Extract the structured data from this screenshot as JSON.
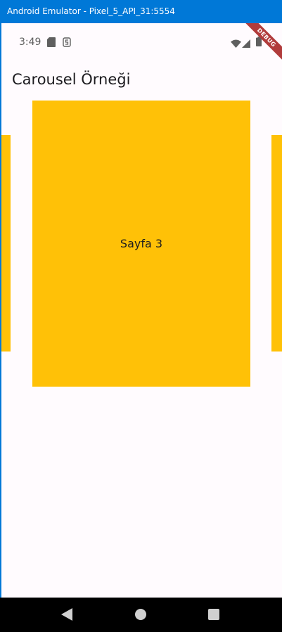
{
  "window": {
    "title": "Android Emulator - Pixel_5_API_31:5554"
  },
  "status_bar": {
    "time": "3:49",
    "icons": [
      "sd-card-icon",
      "notification-s-icon",
      "wifi-icon",
      "cell-signal-icon",
      "battery-icon"
    ]
  },
  "app_bar": {
    "title": "Carousel Örneği"
  },
  "carousel": {
    "current_page_label": "Sayfa 3",
    "page_color": "#ffc107"
  },
  "debug_banner": {
    "label": "DEBUG"
  },
  "nav_bar": {
    "buttons": [
      "back-icon",
      "home-icon",
      "recents-icon"
    ]
  },
  "colors": {
    "titlebar": "#0078d7",
    "screen_background": "#fffbfe",
    "page": "#ffc107",
    "debug_ribbon": "#b13b3b",
    "nav_bar": "#000000"
  }
}
